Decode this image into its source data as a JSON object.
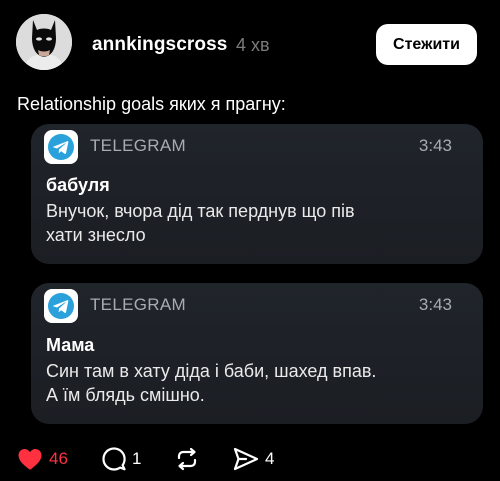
{
  "post": {
    "username": "annkingscross",
    "time_ago": "4 хв",
    "follow_label": "Стежити",
    "caption": "Relationship goals яких я прагну:"
  },
  "notifications": [
    {
      "app": "TELEGRAM",
      "time": "3:43",
      "sender": "бабуля",
      "message": "Внучок, вчора дід так перднув що пів хати знесло"
    },
    {
      "app": "TELEGRAM",
      "time": "3:43",
      "sender": "Мама",
      "message": "Син там в хату діда і баби, шахед впав. А їм блядь смішно."
    }
  ],
  "actions": {
    "likes": "46",
    "replies": "1",
    "shares": "4"
  },
  "colors": {
    "background": "#000000",
    "card": "#1e2127",
    "telegram": "#2aa1da",
    "like": "#ff3040",
    "muted": "#7b7b7b"
  },
  "icons": [
    "avatar-batman",
    "telegram-icon",
    "heart-icon",
    "reply-icon",
    "repost-icon",
    "share-icon"
  ]
}
